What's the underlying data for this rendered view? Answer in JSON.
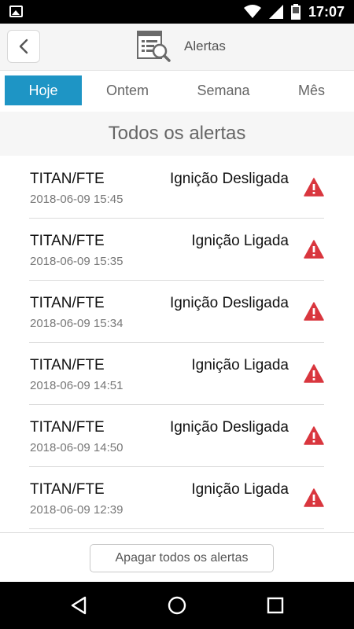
{
  "status_bar": {
    "time": "17:07"
  },
  "header": {
    "title": "Alertas"
  },
  "tabs": [
    {
      "label": "Hoje",
      "active": true
    },
    {
      "label": "Ontem",
      "active": false
    },
    {
      "label": "Semana",
      "active": false
    },
    {
      "label": "Mês",
      "active": false
    }
  ],
  "section_title": "Todos os alertas",
  "alerts": [
    {
      "device": "TITAN/FTE",
      "event": "Ignição Desligada",
      "time": "2018-06-09 15:45"
    },
    {
      "device": "TITAN/FTE",
      "event": "Ignição Ligada",
      "time": "2018-06-09 15:35"
    },
    {
      "device": "TITAN/FTE",
      "event": "Ignição Desligada",
      "time": "2018-06-09 15:34"
    },
    {
      "device": "TITAN/FTE",
      "event": "Ignição Ligada",
      "time": "2018-06-09 14:51"
    },
    {
      "device": "TITAN/FTE",
      "event": "Ignição Desligada",
      "time": "2018-06-09 14:50"
    },
    {
      "device": "TITAN/FTE",
      "event": "Ignição Ligada",
      "time": "2018-06-09 12:39"
    }
  ],
  "footer": {
    "clear_label": "Apagar todos os alertas"
  },
  "colors": {
    "accent": "#1e95c5",
    "warning": "#d9363e"
  },
  "icons": {
    "alert": "warning-triangle-icon",
    "header": "report-search-icon"
  }
}
